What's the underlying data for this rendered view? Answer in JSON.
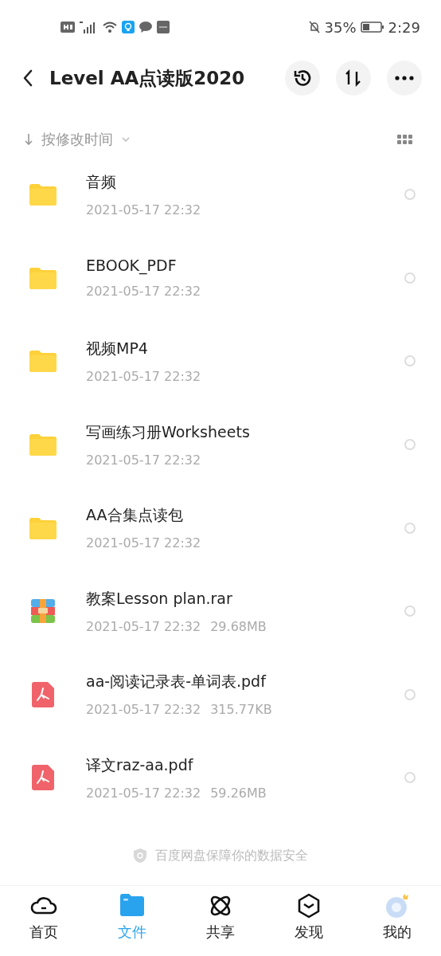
{
  "status_bar": {
    "battery": "35%",
    "time": "2:29"
  },
  "header": {
    "title": "Level AA点读版2020"
  },
  "sort_bar": {
    "label": "按修改时间"
  },
  "files": [
    {
      "kind": "folder",
      "name": "音频",
      "date": "2021-05-17  22:32",
      "selected": false
    },
    {
      "kind": "folder",
      "name": "EBOOK_PDF",
      "date": "2021-05-17  22:32",
      "selected": false
    },
    {
      "kind": "folder",
      "name": "视频MP4",
      "date": "2021-05-17  22:32",
      "selected": false
    },
    {
      "kind": "folder",
      "name": "写画练习册Worksheets",
      "date": "2021-05-17  22:32",
      "selected": false
    },
    {
      "kind": "folder",
      "name": "AA合集点读包",
      "date": "2021-05-17  22:32",
      "selected": false
    },
    {
      "kind": "archive",
      "name": "教案Lesson plan.rar",
      "date": "2021-05-17  22:32",
      "size": "29.68MB",
      "selected": false
    },
    {
      "kind": "pdf",
      "name": "aa-阅读记录表-单词表.pdf",
      "date": "2021-05-17  22:32",
      "size": "315.77KB",
      "selected": false
    },
    {
      "kind": "pdf",
      "name": "译文raz-aa.pdf",
      "date": "2021-05-17  22:32",
      "size": "59.26MB",
      "selected": false
    }
  ],
  "footer_note": "百度网盘保障你的数据安全",
  "tabs": [
    {
      "kind": "home",
      "label": "首页",
      "selected": false
    },
    {
      "kind": "files",
      "label": "文件",
      "selected": true
    },
    {
      "kind": "share",
      "label": "共享",
      "selected": false
    },
    {
      "kind": "discover",
      "label": "发现",
      "selected": false
    },
    {
      "kind": "me",
      "label": "我的",
      "selected": false
    }
  ]
}
